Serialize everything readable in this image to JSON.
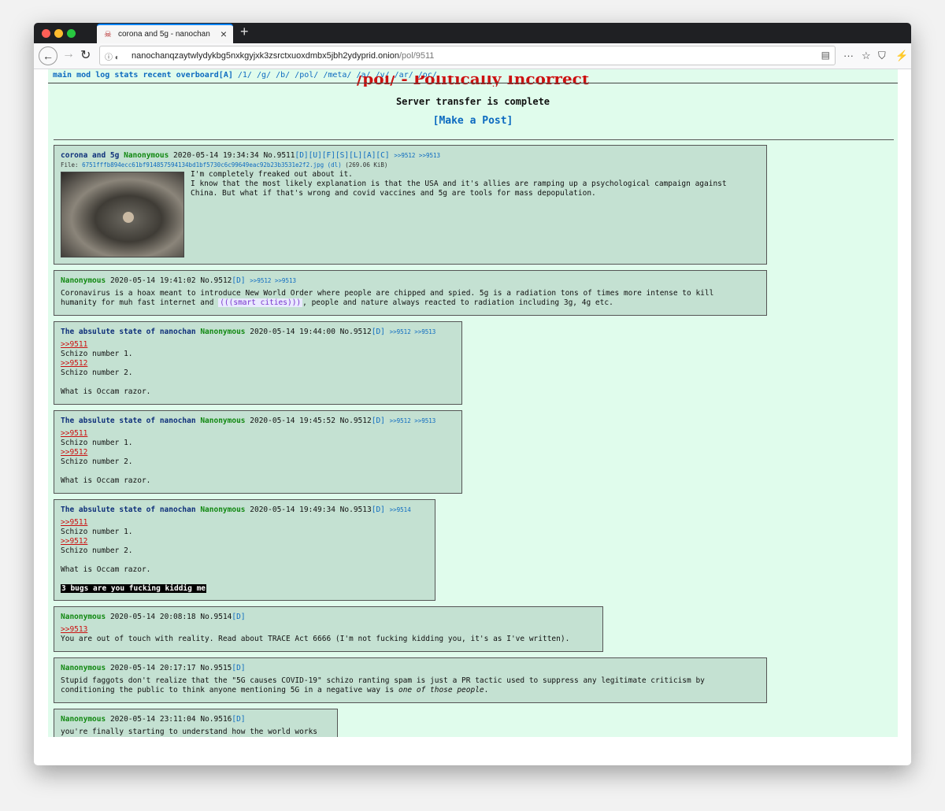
{
  "browser": {
    "tab_title": "corona and 5g - nanochan",
    "tab_favicon": "skull-icon",
    "new_tab": "+",
    "url_host": "nanochanqzaytwlydykbg5nxkgyjxk3zsrctxuoxdmbx5jbh2ydyprid.onion",
    "url_path": "/pol/9511"
  },
  "nav": {
    "items": [
      "main",
      "mod",
      "log",
      "stats",
      "recent",
      "overboard[A]"
    ],
    "boards": [
      "/1/",
      "/g/",
      "/b/",
      "/pol/",
      "/meta/",
      "/a/",
      "/v/",
      "/ar/",
      "/oc/"
    ]
  },
  "board": {
    "title": "/pol/ - Politically Incorrect",
    "announcement": "Server transfer is complete",
    "make_post": "[Make a Post]"
  },
  "posts": [
    {
      "subject": "corona and 5g",
      "name": "Nanonymous",
      "date": "2020-05-14 19:34:34",
      "no": "No.9511",
      "actions": "[D][U][F][S][L][A][C]",
      "backlinks": ">>9512 >>9513",
      "file_label": "File:",
      "file_name": "6751fffb894ecc61bf914857594134bd1bf5730c6c99649eac92b23b3531e2f2.jpg",
      "file_dl": "(dl)",
      "file_size": "(269.06 KiB)",
      "body1": "I'm completely freaked out about it.",
      "body2": "I know that the most likely explanation is that the USA and it's allies are ramping up a psychological campaign against",
      "body3": "China. But what if that's wrong and covid vaccines and 5g are tools for mass depopulation."
    },
    {
      "name": "Nanonymous",
      "date": "2020-05-14 19:41:02",
      "no": "No.9512",
      "actions": "[D]",
      "backlinks": ">>9512 >>9513",
      "body1": "Coronavirus is a hoax meant to introduce New World Order where people are chipped and spied. 5g is a radiation tons of times more intense to kill",
      "body2a": "humanity for muh fast internet and ",
      "body2b": "(((smart cities)))",
      "body2c": ", people and nature always reacted to radiation including 3g, 4g etc."
    },
    {
      "subject": "The absulute state of nanochan",
      "name": "Nanonymous",
      "date": "2020-05-14 19:44:00",
      "no": "No.9512",
      "actions": "[D]",
      "backlinks": ">>9512 >>9513",
      "q1": ">>9511",
      "l1": "Schizo number 1.",
      "q2": ">>9512",
      "l2": "Schizo number 2.",
      "l3": "What is Occam razor."
    },
    {
      "subject": "The absulute state of nanochan",
      "name": "Nanonymous",
      "date": "2020-05-14 19:45:52",
      "no": "No.9512",
      "actions": "[D]",
      "backlinks": ">>9512 >>9513",
      "q1": ">>9511",
      "l1": "Schizo number 1.",
      "q2": ">>9512",
      "l2": "Schizo number 2.",
      "l3": "What is Occam razor."
    },
    {
      "subject": "The absulute state of nanochan",
      "name": "Nanonymous",
      "date": "2020-05-14 19:49:34",
      "no": "No.9513",
      "actions": "[D]",
      "backlinks": ">>9514",
      "q1": ">>9511",
      "l1": "Schizo number 1.",
      "q2": ">>9512",
      "l2": "Schizo number 2.",
      "l3": "What is Occam razor.",
      "spoiler": "3 bugs are you fucking kiddig me"
    },
    {
      "name": "Nanonymous",
      "date": "2020-05-14 20:08:18",
      "no": "No.9514",
      "actions": "[D]",
      "q1": ">>9513",
      "body1": "You are out of touch with reality. Read about TRACE Act 6666 (I'm not fucking kidding you, it's as I've written)."
    },
    {
      "name": "Nanonymous",
      "date": "2020-05-14 20:17:17",
      "no": "No.9515",
      "actions": "[D]",
      "body1": "Stupid faggots don't realize that the \"5G causes COVID-19\" schizo ranting spam is just a PR tactic used to suppress any legitimate criticism by",
      "body2a": "conditioning the public to think anyone mentioning 5G in a negative way is ",
      "body2b": "one of those people",
      "body2c": "."
    },
    {
      "name": "Nanonymous",
      "date": "2020-05-14 23:11:04",
      "no": "No.9516",
      "actions": "[D]",
      "body1": "you're finally starting to understand how the world works"
    }
  ]
}
